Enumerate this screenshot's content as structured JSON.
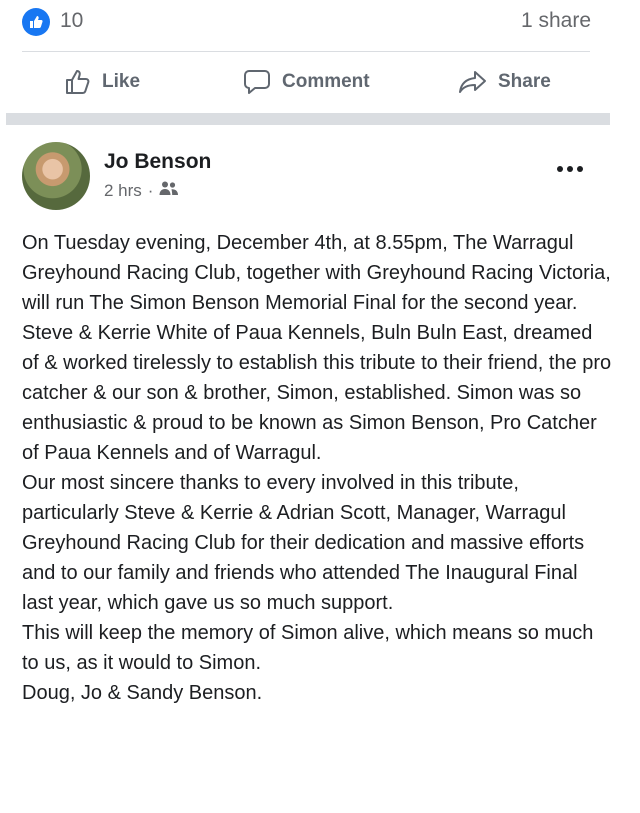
{
  "reactions": {
    "like_count": "10",
    "share_count": "1 share"
  },
  "actions": {
    "like": "Like",
    "comment": "Comment",
    "share": "Share"
  },
  "post": {
    "author": "Jo Benson",
    "time": "2 hrs",
    "separator": "·",
    "audience_icon": "friends-icon",
    "paragraphs": [
      "On Tuesday evening, December 4th, at 8.55pm, The Warragul Greyhound Racing Club, together with Greyhound Racing Victoria, will run The Simon Benson Memorial Final for the second year.",
      "Steve & Kerrie White of Paua Kennels, Buln Buln East, dreamed of & worked tirelessly to establish this tribute to their friend, the pro catcher & our son & brother, Simon, established. Simon was so enthusiastic & proud to be known as Simon Benson, Pro Catcher of Paua Kennels and of Warragul.",
      "Our most sincere thanks to every involved in this tribute, particularly Steve & Kerrie & Adrian Scott, Manager, Warragul Greyhound Racing Club for their dedication and massive efforts and to our family and friends who attended The Inaugural Final last year, which gave us so much support.",
      "This will keep the memory of Simon alive, which means so much to us, as it would to Simon.",
      "Doug, Jo & Sandy Benson."
    ]
  },
  "colors": {
    "accent": "#1877f2",
    "secondary_text": "#65676b",
    "separator": "#dadde1"
  }
}
